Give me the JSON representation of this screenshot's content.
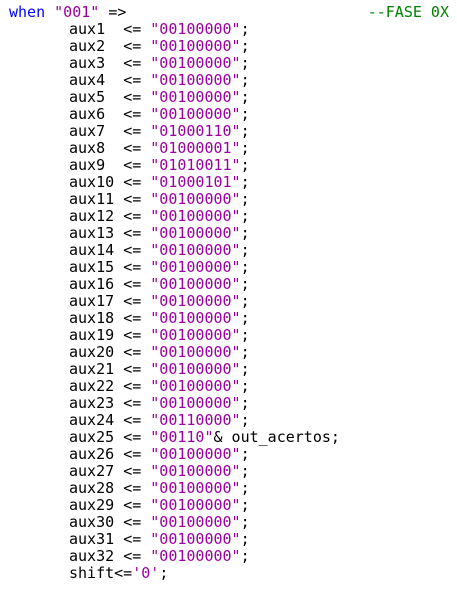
{
  "header": {
    "keyword": "when",
    "selector": "\"001\"",
    "arrow": " =>",
    "comment": "--FASE 0X"
  },
  "assignments": [
    {
      "name": "aux1  ",
      "op": "<= ",
      "value": "\"00100000\"",
      "end": ";"
    },
    {
      "name": "aux2  ",
      "op": "<= ",
      "value": "\"00100000\"",
      "end": ";"
    },
    {
      "name": "aux3  ",
      "op": "<= ",
      "value": "\"00100000\"",
      "end": ";"
    },
    {
      "name": "aux4  ",
      "op": "<= ",
      "value": "\"00100000\"",
      "end": ";"
    },
    {
      "name": "aux5  ",
      "op": "<= ",
      "value": "\"00100000\"",
      "end": ";"
    },
    {
      "name": "aux6  ",
      "op": "<= ",
      "value": "\"00100000\"",
      "end": ";"
    },
    {
      "name": "aux7  ",
      "op": "<= ",
      "value": "\"01000110\"",
      "end": ";"
    },
    {
      "name": "aux8  ",
      "op": "<= ",
      "value": "\"01000001\"",
      "end": ";"
    },
    {
      "name": "aux9  ",
      "op": "<= ",
      "value": "\"01010011\"",
      "end": ";"
    },
    {
      "name": "aux10 ",
      "op": "<= ",
      "value": "\"01000101\"",
      "end": ";"
    },
    {
      "name": "aux11 ",
      "op": "<= ",
      "value": "\"00100000\"",
      "end": ";"
    },
    {
      "name": "aux12 ",
      "op": "<= ",
      "value": "\"00100000\"",
      "end": ";"
    },
    {
      "name": "aux13 ",
      "op": "<= ",
      "value": "\"00100000\"",
      "end": ";"
    },
    {
      "name": "aux14 ",
      "op": "<= ",
      "value": "\"00100000\"",
      "end": ";"
    },
    {
      "name": "aux15 ",
      "op": "<= ",
      "value": "\"00100000\"",
      "end": ";"
    },
    {
      "name": "aux16 ",
      "op": "<= ",
      "value": "\"00100000\"",
      "end": ";"
    },
    {
      "name": "aux17 ",
      "op": "<= ",
      "value": "\"00100000\"",
      "end": ";"
    },
    {
      "name": "aux18 ",
      "op": "<= ",
      "value": "\"00100000\"",
      "end": ";"
    },
    {
      "name": "aux19 ",
      "op": "<= ",
      "value": "\"00100000\"",
      "end": ";"
    },
    {
      "name": "aux20 ",
      "op": "<= ",
      "value": "\"00100000\"",
      "end": ";"
    },
    {
      "name": "aux21 ",
      "op": "<= ",
      "value": "\"00100000\"",
      "end": ";"
    },
    {
      "name": "aux22 ",
      "op": "<= ",
      "value": "\"00100000\"",
      "end": ";"
    },
    {
      "name": "aux23 ",
      "op": "<= ",
      "value": "\"00100000\"",
      "end": ";"
    },
    {
      "name": "aux24 ",
      "op": "<= ",
      "value": "\"00110000\"",
      "end": ";"
    },
    {
      "name": "aux25 ",
      "op": "<= ",
      "value": "\"00110\"",
      "end": "& out_acertos;"
    },
    {
      "name": "aux26 ",
      "op": "<= ",
      "value": "\"00100000\"",
      "end": ";"
    },
    {
      "name": "aux27 ",
      "op": "<= ",
      "value": "\"00100000\"",
      "end": ";"
    },
    {
      "name": "aux28 ",
      "op": "<= ",
      "value": "\"00100000\"",
      "end": ";"
    },
    {
      "name": "aux29 ",
      "op": "<= ",
      "value": "\"00100000\"",
      "end": ";"
    },
    {
      "name": "aux30 ",
      "op": "<= ",
      "value": "\"00100000\"",
      "end": ";"
    },
    {
      "name": "aux31 ",
      "op": "<= ",
      "value": "\"00100000\"",
      "end": ";"
    },
    {
      "name": "aux32 ",
      "op": "<= ",
      "value": "\"00100000\"",
      "end": ";"
    }
  ],
  "last_line": {
    "name": "shift",
    "op": "<=",
    "value": "'0'",
    "end": ";"
  },
  "colors": {
    "keyword": "#0000ff",
    "string": "#9a00a0",
    "comment": "#008000",
    "text": "#000000"
  }
}
